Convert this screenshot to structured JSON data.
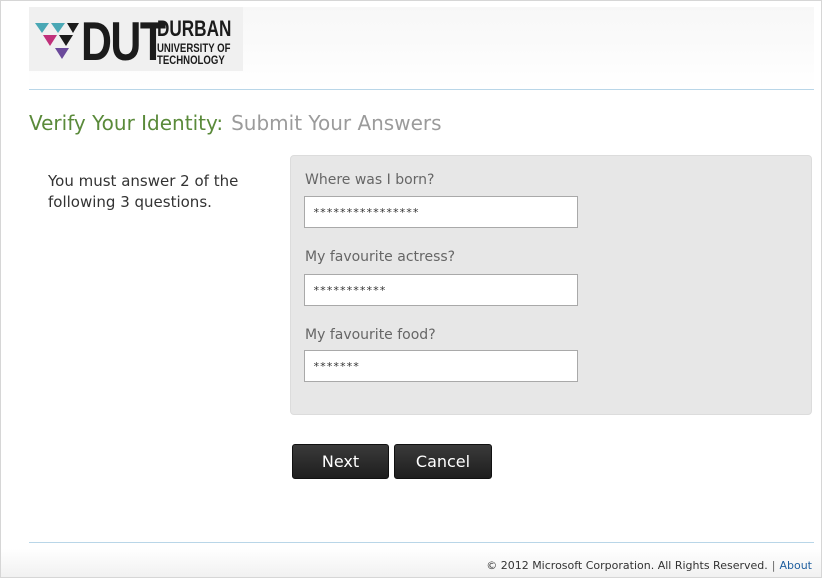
{
  "brand": {
    "logo_mark": "DUT",
    "logo_line1": "DURBAN",
    "logo_line2": "UNIVERSITY OF",
    "logo_line3": "TECHNOLOGY",
    "colors": {
      "teal": "#4aa8b5",
      "magenta": "#c0307a",
      "purple": "#6b4a9b",
      "green_title": "#5a8a3a"
    }
  },
  "page": {
    "title_main": "Verify Your Identity:",
    "title_sub": "Submit Your Answers",
    "instructions": "You must answer 2 of the following 3 questions."
  },
  "questions": [
    {
      "label": "Where was I born?",
      "value": "****************"
    },
    {
      "label": "My favourite actress?",
      "value": "***********"
    },
    {
      "label": "My favourite food?",
      "value": "*******"
    }
  ],
  "buttons": {
    "next": "Next",
    "cancel": "Cancel"
  },
  "footer": {
    "copyright": "© 2012 Microsoft Corporation. All Rights Reserved.",
    "separator": "|",
    "about": "About"
  }
}
